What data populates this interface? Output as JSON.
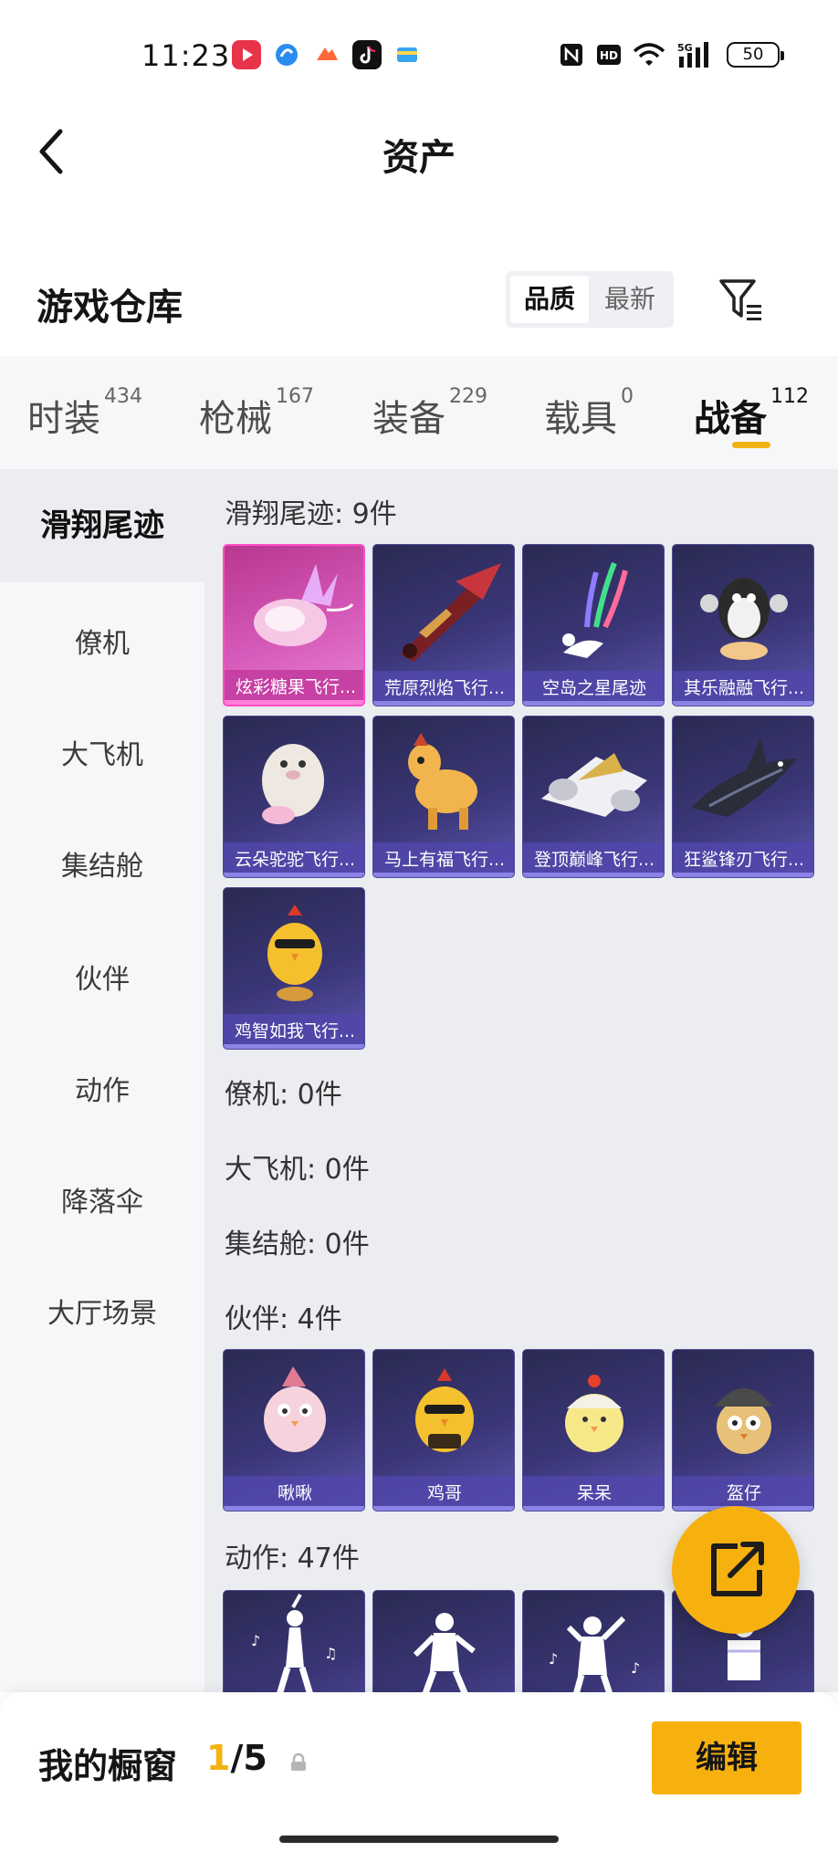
{
  "status_bar": {
    "time": "11:23",
    "battery": "50"
  },
  "header": {
    "title": "资产"
  },
  "warehouse": {
    "title": "游戏仓库",
    "sort_options": [
      "品质",
      "最新"
    ],
    "sort_selected": "品质"
  },
  "tabs": [
    {
      "label": "时装",
      "count": "434"
    },
    {
      "label": "枪械",
      "count": "167"
    },
    {
      "label": "装备",
      "count": "229"
    },
    {
      "label": "载具",
      "count": "0"
    },
    {
      "label": "战备",
      "count": "112",
      "active": true
    }
  ],
  "sidebar": {
    "items": [
      "滑翔尾迹",
      "僚机",
      "大飞机",
      "集结舱",
      "伙伴",
      "动作",
      "降落伞",
      "大厅场景"
    ],
    "active": "滑翔尾迹"
  },
  "sections": {
    "glide": {
      "header": "滑翔尾迹: 9件",
      "items": [
        "炫彩糖果飞行...",
        "荒原烈焰飞行...",
        "空岛之星尾迹",
        "其乐融融飞行...",
        "云朵驼驼飞行...",
        "马上有福飞行...",
        "登顶巅峰飞行...",
        "狂鲨锋刃飞行...",
        "鸡智如我飞行..."
      ]
    },
    "wingman": {
      "header": "僚机: 0件"
    },
    "plane": {
      "header": "大飞机: 0件"
    },
    "pod": {
      "header": "集结舱: 0件"
    },
    "partner": {
      "header": "伙伴: 4件",
      "items": [
        "啾啾",
        "鸡哥",
        "呆呆",
        "盔仔"
      ]
    },
    "emote": {
      "header": "动作: 47件"
    }
  },
  "bottom_bar": {
    "title": "我的橱窗",
    "count_current": "1",
    "count_total": "/5",
    "edit_label": "编辑"
  },
  "colors": {
    "accent": "#f7b10f",
    "card_bg": "#3a3677",
    "card_highlight": "#d65ab9"
  }
}
